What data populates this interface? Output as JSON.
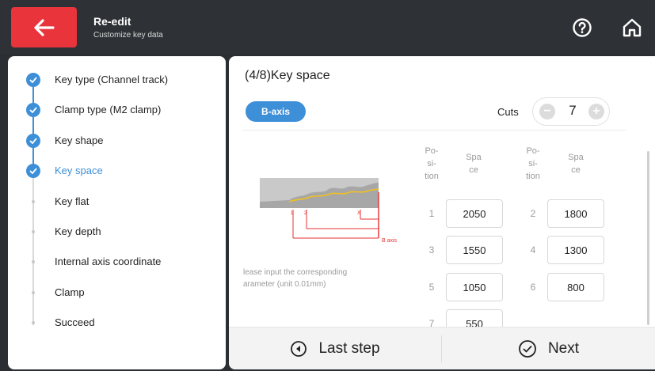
{
  "header": {
    "title": "Re-edit",
    "subtitle": "Customize key data"
  },
  "sidebar": {
    "steps": [
      {
        "label": "Key type (Channel track)",
        "state": "done"
      },
      {
        "label": "Clamp type (M2 clamp)",
        "state": "done"
      },
      {
        "label": "Key shape",
        "state": "done"
      },
      {
        "label": "Key space",
        "state": "active"
      },
      {
        "label": "Key flat",
        "state": "pending"
      },
      {
        "label": "Key depth",
        "state": "pending"
      },
      {
        "label": "Internal axis coordinate",
        "state": "pending"
      },
      {
        "label": "Clamp",
        "state": "pending"
      },
      {
        "label": "Succeed",
        "state": "pending"
      }
    ]
  },
  "main": {
    "title": "(4/8)Key space",
    "axis_button": "B-axis",
    "cuts_label": "Cuts",
    "cuts_value": "7",
    "cuts_minus": "−",
    "cuts_plus": "+",
    "diagram_labels": {
      "b_axis": "B axis",
      "m1": "1",
      "m2": "2",
      "mx": "X"
    },
    "note_line1": "lease input the corresponding",
    "note_line2": "arameter (unit 0.01mm)",
    "column_headers": {
      "position": "Po-\nsi-\ntion",
      "space": "Spa\nce"
    },
    "cuts": [
      {
        "position": "1",
        "value": "2050"
      },
      {
        "position": "2",
        "value": "1800"
      },
      {
        "position": "3",
        "value": "1550"
      },
      {
        "position": "4",
        "value": "1300"
      },
      {
        "position": "5",
        "value": "1050"
      },
      {
        "position": "6",
        "value": "800"
      },
      {
        "position": "7",
        "value": "550"
      }
    ]
  },
  "footer": {
    "last_step": "Last step",
    "next": "Next"
  },
  "colors": {
    "accent": "#3d8fd8",
    "back_button": "#e9343c",
    "header_bg": "#2e3236"
  }
}
